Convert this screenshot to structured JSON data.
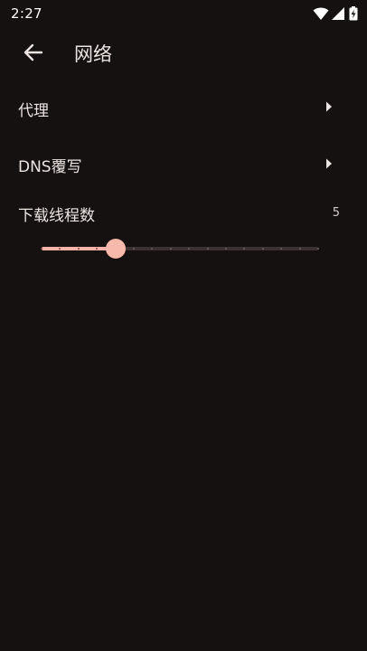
{
  "status_bar": {
    "time": "2:27",
    "icons": [
      "wifi-icon",
      "cellular-signal-icon",
      "battery-charging-icon"
    ]
  },
  "app_bar": {
    "back_icon": "arrow-left-icon",
    "title": "网络"
  },
  "settings": {
    "proxy": {
      "label": "代理",
      "icon": "chevron-right-icon"
    },
    "dns_override": {
      "label": "DNS覆写",
      "icon": "chevron-right-icon"
    },
    "download_threads": {
      "label": "下载线程数",
      "value": "5",
      "min": 1,
      "max": 16,
      "current": 5
    }
  },
  "colors": {
    "background": "#151110",
    "accent": "#f7b9ab",
    "track_inactive": "#3a3130",
    "text": "#ece4e1"
  }
}
